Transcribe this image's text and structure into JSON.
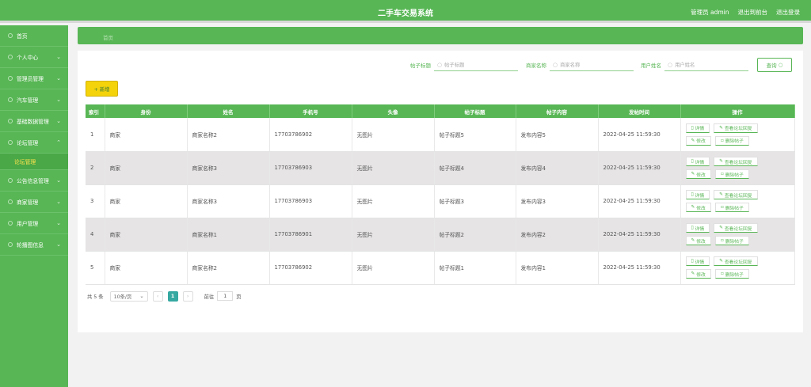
{
  "header": {
    "title": "二手车交易系统",
    "admin_label": "管理员 admin",
    "to_front": "退出到前台",
    "logout": "退出登录"
  },
  "sidebar": {
    "items": [
      {
        "label": "首页",
        "arrow": ""
      },
      {
        "label": "个人中心",
        "arrow": "⌄"
      },
      {
        "label": "管理员管理",
        "arrow": "⌄"
      },
      {
        "label": "汽车管理",
        "arrow": "⌄"
      },
      {
        "label": "基础数据管理",
        "arrow": "⌄"
      },
      {
        "label": "论坛管理",
        "arrow": "⌃"
      }
    ],
    "submenu": "论坛管理",
    "items_after": [
      {
        "label": "公告信息管理",
        "arrow": "⌄"
      },
      {
        "label": "商家管理",
        "arrow": "⌄"
      },
      {
        "label": "用户管理",
        "arrow": "⌄"
      },
      {
        "label": "轮播图信息",
        "arrow": "⌄"
      }
    ]
  },
  "breadcrumb": "首页",
  "search": {
    "f1_label": "帖子标题",
    "f1_placeholder": "帖子标题",
    "f2_label": "商家名称",
    "f2_placeholder": "商家名称",
    "f3_label": "用户姓名",
    "f3_placeholder": "用户姓名",
    "query": "查询"
  },
  "add_button": "+ 新增",
  "table": {
    "headers": [
      "索引",
      "身份",
      "姓名",
      "手机号",
      "头像",
      "帖子标题",
      "帖子内容",
      "发帖时间",
      "操作"
    ],
    "rows": [
      [
        "1",
        "商家",
        "商家名称2",
        "17703786902",
        "无图片",
        "帖子标题5",
        "发布内容5",
        "2022-04-25 11:59:30"
      ],
      [
        "2",
        "商家",
        "商家名称3",
        "17703786903",
        "无图片",
        "帖子标题4",
        "发布内容4",
        "2022-04-25 11:59:30"
      ],
      [
        "3",
        "商家",
        "商家名称3",
        "17703786903",
        "无图片",
        "帖子标题3",
        "发布内容3",
        "2022-04-25 11:59:30"
      ],
      [
        "4",
        "商家",
        "商家名称1",
        "17703786901",
        "无图片",
        "帖子标题2",
        "发布内容2",
        "2022-04-25 11:59:30"
      ],
      [
        "5",
        "商家",
        "商家名称2",
        "17703786902",
        "无图片",
        "帖子标题1",
        "发布内容1",
        "2022-04-25 11:59:30"
      ]
    ],
    "ops": {
      "detail": "详情",
      "reply": "查看论坛回复",
      "edit": "修改",
      "delete": "删除帖子",
      "detail_icon": "document-icon",
      "reply_icon": "edit-icon",
      "edit_icon": "edit-icon",
      "delete_icon": "trash-icon"
    }
  },
  "pager": {
    "total": "共 5 条",
    "page_size": "10条/页",
    "current": "1",
    "goto_prefix": "前往",
    "goto_value": "1",
    "goto_suffix": "页"
  },
  "colors": {
    "primary": "#58b655",
    "accent_yellow": "#f4d30a",
    "pager_active": "#35a8a1"
  }
}
